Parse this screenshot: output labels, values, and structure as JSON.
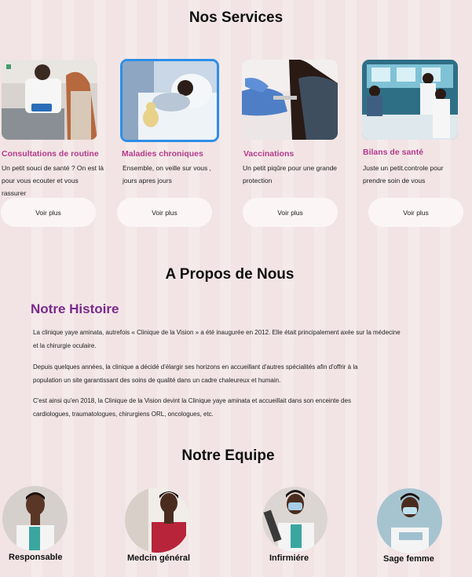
{
  "services": {
    "heading": "Nos Services",
    "cards": [
      {
        "title": "Consultations de routine",
        "description": "Un petit souci de santé ? On est là pour vous ecouter et vous rassurer",
        "button": "Voir plus"
      },
      {
        "title": "Maladies chroniques",
        "description": "Ensemble,  on veille sur vous , jours apres jours",
        "button": "Voir plus"
      },
      {
        "title": "Vaccinations",
        "description": "Un petit piqûre pour une grande protection",
        "button": "Voir plus"
      },
      {
        "title": "Bilans de santé",
        "description": "Juste un petit.controle pour prendre soin de vous",
        "button": "Voir plus"
      }
    ]
  },
  "about": {
    "heading": "A Propos de Nous",
    "story_title": "Notre Histoire",
    "paragraphs": [
      "La clinique yaye aminata, autrefois « Clinique de la Vision » a été inaugurée en 2012. Elle était principalement axée sur la médecine et la chirurgie oculaire.",
      "Depuis quelques années, la clinique a décidé d'élargir ses horizons en accueillant d'autres spécialités afin d'offrir à la population un site garantissant des soins de qualité dans un cadre chaleureux et humain.",
      "C'est ainsi qu'en 2018, la Clinique de la Vision devint la Clinique yaye aminata et accueillait dans son enceinte des cardiologues, traumatologues, chirurgiens ORL, oncologues, etc."
    ]
  },
  "team": {
    "heading": "Notre Equipe",
    "members": [
      {
        "role": "Responsable"
      },
      {
        "role": "Medcin général"
      },
      {
        "role": "Infirmiére"
      },
      {
        "role": "Sage femme"
      }
    ]
  },
  "colors": {
    "accent": "#b23b8a",
    "story": "#7a2a8c",
    "background": "#f2e4e4",
    "selection": "#2d8ee8"
  }
}
